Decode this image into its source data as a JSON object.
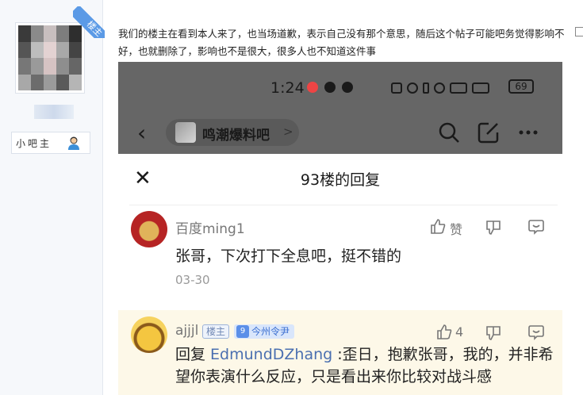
{
  "author": {
    "corner_badge": "楼主",
    "role": "小吧主"
  },
  "post": {
    "text": "我们的楼主在看到本人来了，也当场道歉，表示自己没有那个意思，随后这个帖子可能吧务觉得影响不好，也就删除了，影响也不是很大，很多人也不知道这件事"
  },
  "screenshot": {
    "status_time": "1:24",
    "battery": "69",
    "forum_name": "鸣潮爆料吧",
    "forum_arrow": ">",
    "sheet_title": "93楼的回复",
    "close_glyph": "✕",
    "back_glyph": "‹",
    "replies": [
      {
        "user": "百度ming1",
        "content": "张哥，下次打下全息吧，挺不错的",
        "date": "03-30",
        "like_label": "赞"
      },
      {
        "user": "ajjjl",
        "badge": "楼主",
        "level": "9",
        "title": "今州令尹",
        "like_count": "4",
        "reply_prefix": "回复 ",
        "reply_to": "EdmundDZhang",
        "content": " :歪日，抱歉张哥，我的，并非希望你表演什么反应，只是看出来你比较对战斗感"
      }
    ]
  }
}
